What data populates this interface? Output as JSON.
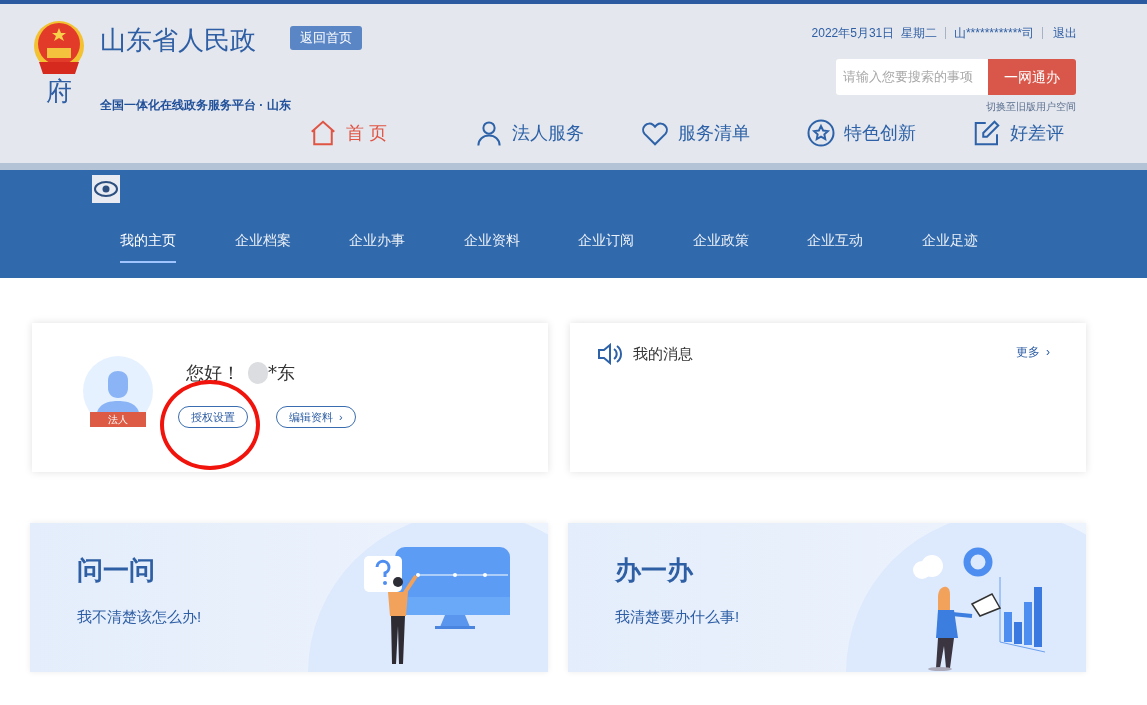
{
  "header": {
    "emblem_char": "府",
    "title": "山东省人民政",
    "home_button": "返回首页",
    "subtitle": "全国一体化在线政务服务平台 · 山东",
    "date": "2022年5月31日  星期二",
    "user": "山************司",
    "logout": "退出",
    "search": {
      "placeholder": "请输入您要搜索的事项",
      "button": "一网通办"
    },
    "switch_link": "切换至旧版用户空间"
  },
  "main_nav": [
    {
      "label": "首 页",
      "selected": true
    },
    {
      "label": "法人服务",
      "selected": false
    },
    {
      "label": "服务清单",
      "selected": false
    },
    {
      "label": "特色创新",
      "selected": false
    },
    {
      "label": "好差评",
      "selected": false
    }
  ],
  "sub_nav": [
    {
      "label": "我的主页",
      "selected": true
    },
    {
      "label": "企业档案",
      "selected": false
    },
    {
      "label": "企业办事",
      "selected": false
    },
    {
      "label": "企业资料",
      "selected": false
    },
    {
      "label": "企业订阅",
      "selected": false
    },
    {
      "label": "企业政策",
      "selected": false
    },
    {
      "label": "企业互动",
      "selected": false
    },
    {
      "label": "企业足迹",
      "selected": false
    }
  ],
  "profile": {
    "badge": "法人",
    "greeting": "您好！",
    "name": "*东",
    "buttons": [
      {
        "label": "授权设置",
        "circled": true
      },
      {
        "label": "编辑资料",
        "arrow": "›",
        "circled": false
      }
    ]
  },
  "messages": {
    "title": "我的消息",
    "more": "更多",
    "more_arrow": "›"
  },
  "banners": [
    {
      "title": "问一问",
      "text": "我不清楚该怎么办!"
    },
    {
      "title": "办一办",
      "text": "我清楚要办什么事!"
    }
  ]
}
